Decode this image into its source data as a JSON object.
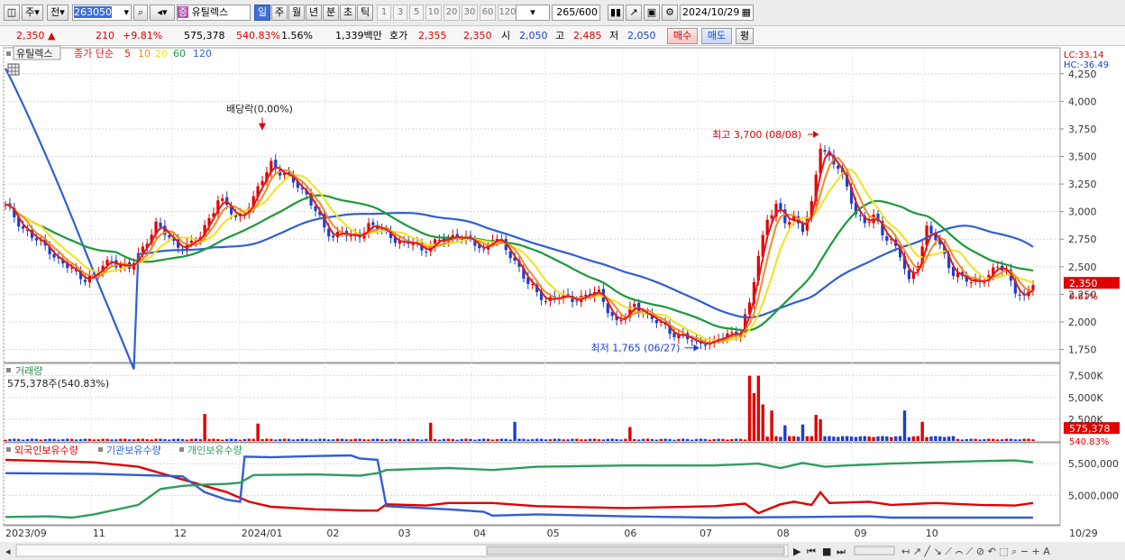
{
  "toolbar": {
    "chart_type_label": "주",
    "prev_label": "전",
    "stock_code": "263050",
    "stock_badge": "증",
    "stock_name": "유틸렉스",
    "periods": [
      "일",
      "주",
      "월",
      "년",
      "분",
      "초",
      "틱"
    ],
    "selected_period": "일",
    "intervals": [
      "1",
      "3",
      "5",
      "10",
      "20",
      "30",
      "60",
      "120"
    ],
    "count": "265",
    "count_max": "/600",
    "date": "2024/10/29"
  },
  "quote": {
    "price": "2,350",
    "change_arrow": "▲",
    "change": "210",
    "change_pct": "+9.81%",
    "volume": "575,378",
    "volume_ratio": "540.83%",
    "turnover": "1.56%",
    "amount": "1,339백만",
    "hoga_label": "호가",
    "ask": "2,355",
    "bid": "2,350",
    "open_label": "시",
    "open": "2,050",
    "high_label": "고",
    "high": "2,485",
    "low_label": "저",
    "low": "2,050",
    "buy_label": "매수",
    "sell_label": "매도",
    "avg_label": "평"
  },
  "colors": {
    "up": "#e00000",
    "down": "#1a3fcf",
    "ma5": "#e31a1c",
    "ma10": "#f28c1d",
    "ma20": "#f2e21d",
    "ma60": "#1a9a3a",
    "ma120": "#2f5fd6",
    "foreign": "#e00000",
    "institution": "#2f5fd6",
    "individual": "#2e9e5e"
  },
  "chart_data": [
    {
      "type": "candlestick",
      "legend": {
        "name": "유틸렉스",
        "series": "종가 단순",
        "periods": [
          "5",
          "10",
          "20",
          "60",
          "120"
        ]
      },
      "x_ticks": [
        "2023/09",
        "11",
        "12",
        "2024/01",
        "02",
        "03",
        "04",
        "05",
        "06",
        "07",
        "08",
        "09",
        "10",
        "10/29"
      ],
      "y_ticks": [
        "4,250",
        "4,000",
        "3,750",
        "3,500",
        "3,250",
        "3,000",
        "2,750",
        "2,500",
        "2,250",
        "2,000",
        "1,750"
      ],
      "ylim": [
        1640,
        4420
      ],
      "lc_label": "LC:33.14",
      "hc_label": "HC:-36.49",
      "last_price_label": "2,350",
      "last_change_label": "9.81%",
      "annotations": [
        {
          "text": "배당락(0.00%)",
          "date": "2023/12",
          "value": 3720
        },
        {
          "text": "최고 3,700 (08/08)",
          "date": "2024/08/08",
          "value": 3700
        },
        {
          "text": "최저 1,765 (06/27)",
          "date": "2024/06/27",
          "value": 1765
        }
      ],
      "ma_values": {
        "ma5": 2350,
        "ma10": 2420,
        "ma20": 2470,
        "ma60": 2700,
        "ma120": 2420
      },
      "close_path": [
        [
          0,
          3050
        ],
        [
          2,
          2950
        ],
        [
          4,
          2850
        ],
        [
          6,
          2780
        ],
        [
          8,
          2700
        ],
        [
          10,
          2650
        ],
        [
          12,
          2560
        ],
        [
          14,
          2500
        ],
        [
          16,
          2430
        ],
        [
          18,
          2400
        ],
        [
          20,
          2420
        ],
        [
          22,
          2500
        ],
        [
          24,
          2560
        ],
        [
          26,
          2520
        ],
        [
          28,
          2480
        ],
        [
          30,
          2600
        ],
        [
          32,
          2750
        ],
        [
          34,
          2880
        ],
        [
          36,
          2800
        ],
        [
          38,
          2720
        ],
        [
          40,
          2680
        ],
        [
          42,
          2700
        ],
        [
          44,
          2780
        ],
        [
          46,
          2950
        ],
        [
          48,
          3100
        ],
        [
          50,
          3050
        ],
        [
          52,
          2950
        ],
        [
          54,
          3000
        ],
        [
          56,
          3100
        ],
        [
          58,
          3300
        ],
        [
          60,
          3450
        ],
        [
          62,
          3350
        ],
        [
          64,
          3300
        ],
        [
          66,
          3250
        ],
        [
          68,
          3150
        ],
        [
          70,
          3000
        ],
        [
          72,
          2850
        ],
        [
          74,
          2780
        ],
        [
          76,
          2820
        ],
        [
          78,
          2750
        ],
        [
          80,
          2800
        ],
        [
          82,
          2880
        ],
        [
          84,
          2850
        ],
        [
          86,
          2800
        ],
        [
          88,
          2760
        ],
        [
          90,
          2700
        ],
        [
          92,
          2720
        ],
        [
          94,
          2650
        ],
        [
          96,
          2700
        ],
        [
          98,
          2730
        ],
        [
          100,
          2750
        ],
        [
          102,
          2800
        ],
        [
          104,
          2750
        ],
        [
          106,
          2700
        ],
        [
          108,
          2650
        ],
        [
          110,
          2780
        ],
        [
          112,
          2700
        ],
        [
          114,
          2600
        ],
        [
          116,
          2500
        ],
        [
          118,
          2350
        ],
        [
          120,
          2250
        ],
        [
          122,
          2200
        ],
        [
          124,
          2230
        ],
        [
          126,
          2220
        ],
        [
          128,
          2200
        ],
        [
          130,
          2230
        ],
        [
          132,
          2260
        ],
        [
          134,
          2250
        ],
        [
          136,
          2120
        ],
        [
          138,
          2000
        ],
        [
          140,
          2050
        ],
        [
          142,
          2150
        ],
        [
          144,
          2100
        ],
        [
          146,
          2020
        ],
        [
          148,
          1980
        ],
        [
          150,
          1920
        ],
        [
          152,
          1880
        ],
        [
          154,
          1850
        ],
        [
          156,
          1800
        ],
        [
          158,
          1830
        ],
        [
          160,
          1810
        ],
        [
          162,
          1860
        ],
        [
          164,
          1900
        ],
        [
          166,
          1920
        ],
        [
          168,
          2150
        ],
        [
          170,
          2600
        ],
        [
          172,
          2950
        ],
        [
          174,
          3050
        ],
        [
          176,
          2900
        ],
        [
          178,
          2950
        ],
        [
          180,
          2850
        ],
        [
          182,
          3050
        ],
        [
          184,
          3600
        ],
        [
          186,
          3500
        ],
        [
          188,
          3400
        ],
        [
          190,
          3200
        ],
        [
          192,
          3000
        ],
        [
          194,
          2900
        ],
        [
          196,
          2950
        ],
        [
          198,
          2800
        ],
        [
          200,
          2750
        ],
        [
          202,
          2600
        ],
        [
          204,
          2350
        ],
        [
          206,
          2550
        ],
        [
          208,
          2850
        ],
        [
          210,
          2750
        ],
        [
          212,
          2600
        ],
        [
          214,
          2450
        ],
        [
          216,
          2400
        ],
        [
          218,
          2350
        ],
        [
          220,
          2380
        ],
        [
          222,
          2420
        ],
        [
          224,
          2500
        ],
        [
          226,
          2450
        ],
        [
          228,
          2300
        ],
        [
          230,
          2200
        ],
        [
          232,
          2350
        ]
      ]
    },
    {
      "type": "bar",
      "title": "거래량",
      "info_label": "575,378주(540.83%)",
      "y_ticks": [
        "7,500K",
        "5,000K",
        "2,500K"
      ],
      "ylim": [
        0,
        8500000
      ],
      "last_value_label": "575,378",
      "last_pct_label": "540.83%",
      "spikes": [
        {
          "i": 45,
          "value": 3100000
        },
        {
          "i": 57,
          "value": 2000000
        },
        {
          "i": 96,
          "value": 2100000
        },
        {
          "i": 115,
          "value": 2200000
        },
        {
          "i": 141,
          "value": 1600000
        },
        {
          "i": 168,
          "value": 7500000
        },
        {
          "i": 169,
          "value": 5500000
        },
        {
          "i": 170,
          "value": 7500000
        },
        {
          "i": 171,
          "value": 4200000
        },
        {
          "i": 173,
          "value": 3500000
        },
        {
          "i": 176,
          "value": 1800000
        },
        {
          "i": 180,
          "value": 1900000
        },
        {
          "i": 183,
          "value": 3000000
        },
        {
          "i": 184,
          "value": 2500000
        },
        {
          "i": 203,
          "value": 3500000
        },
        {
          "i": 207,
          "value": 2200000
        }
      ]
    },
    {
      "type": "line",
      "series_names": [
        "외국인보유수량",
        "기관보유수량",
        "개인보유수량"
      ],
      "y_ticks": [
        "5,500,000",
        "5,000,000"
      ],
      "ylim": [
        4550000,
        5800000
      ],
      "x_ticks": [
        "2023/09",
        "11",
        "12",
        "2024/01",
        "02",
        "03",
        "04",
        "05",
        "06",
        "07",
        "08",
        "09",
        "10",
        "10/29"
      ],
      "series": [
        {
          "name": "외국인보유수량",
          "points": [
            [
              0,
              5560000
            ],
            [
              10,
              5540000
            ],
            [
              20,
              5520000
            ],
            [
              30,
              5450000
            ],
            [
              40,
              5250000
            ],
            [
              45,
              5150000
            ],
            [
              50,
              5050000
            ],
            [
              55,
              4900000
            ],
            [
              60,
              4820000
            ],
            [
              70,
              4780000
            ],
            [
              80,
              4760000
            ],
            [
              84,
              4760000
            ],
            [
              86,
              4860000
            ],
            [
              95,
              4840000
            ],
            [
              100,
              4880000
            ],
            [
              110,
              4880000
            ],
            [
              120,
              4830000
            ],
            [
              140,
              4800000
            ],
            [
              160,
              4830000
            ],
            [
              167,
              4870000
            ],
            [
              170,
              4720000
            ],
            [
              175,
              4860000
            ],
            [
              178,
              4900000
            ],
            [
              182,
              4850000
            ],
            [
              184,
              5050000
            ],
            [
              186,
              4880000
            ],
            [
              195,
              4900000
            ],
            [
              200,
              4850000
            ],
            [
              210,
              4880000
            ],
            [
              220,
              4850000
            ],
            [
              228,
              4840000
            ],
            [
              232,
              4880000
            ]
          ]
        },
        {
          "name": "기관보유수량",
          "points": [
            [
              0,
              5350000
            ],
            [
              20,
              5340000
            ],
            [
              30,
              5320000
            ],
            [
              40,
              5300000
            ],
            [
              45,
              5050000
            ],
            [
              50,
              4930000
            ],
            [
              53,
              4900000
            ],
            [
              54,
              5610000
            ],
            [
              60,
              5600000
            ],
            [
              70,
              5620000
            ],
            [
              78,
              5630000
            ],
            [
              80,
              5580000
            ],
            [
              84,
              5560000
            ],
            [
              86,
              4830000
            ],
            [
              100,
              4780000
            ],
            [
              108,
              4740000
            ],
            [
              110,
              4680000
            ],
            [
              120,
              4700000
            ],
            [
              140,
              4670000
            ],
            [
              160,
              4650000
            ],
            [
              180,
              4660000
            ],
            [
              195,
              4670000
            ],
            [
              200,
              4650000
            ],
            [
              232,
              4650000
            ]
          ]
        },
        {
          "name": "개인보유수량",
          "points": [
            [
              0,
              4660000
            ],
            [
              10,
              4670000
            ],
            [
              15,
              4650000
            ],
            [
              20,
              4700000
            ],
            [
              30,
              4850000
            ],
            [
              35,
              5100000
            ],
            [
              40,
              5150000
            ],
            [
              45,
              5170000
            ],
            [
              50,
              5180000
            ],
            [
              53,
              5200000
            ],
            [
              56,
              5320000
            ],
            [
              70,
              5330000
            ],
            [
              80,
              5310000
            ],
            [
              84,
              5350000
            ],
            [
              86,
              5400000
            ],
            [
              100,
              5430000
            ],
            [
              110,
              5400000
            ],
            [
              120,
              5450000
            ],
            [
              140,
              5470000
            ],
            [
              160,
              5470000
            ],
            [
              170,
              5500000
            ],
            [
              175,
              5430000
            ],
            [
              180,
              5510000
            ],
            [
              185,
              5450000
            ],
            [
              190,
              5470000
            ],
            [
              200,
              5500000
            ],
            [
              210,
              5520000
            ],
            [
              220,
              5540000
            ],
            [
              228,
              5550000
            ],
            [
              232,
              5520000
            ]
          ]
        }
      ]
    }
  ]
}
